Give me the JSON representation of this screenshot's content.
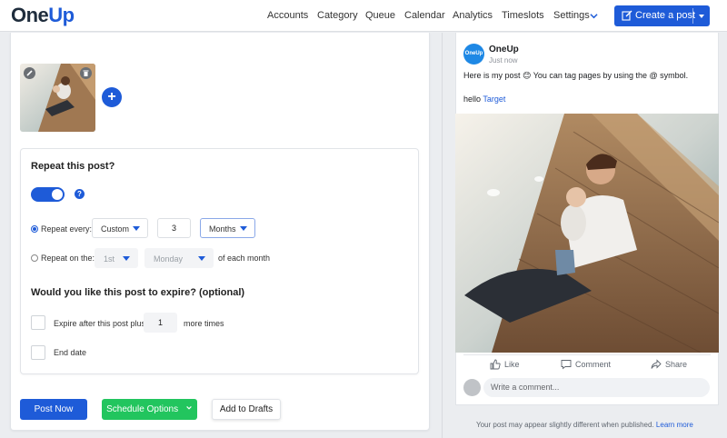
{
  "brand": {
    "logo_one": "One",
    "logo_up": "Up"
  },
  "nav": {
    "items": [
      "Accounts",
      "Category",
      "Queue",
      "Calendar",
      "Analytics",
      "Timeslots",
      "Settings"
    ],
    "create_label": "Create a post"
  },
  "repeat": {
    "title": "Repeat this post?",
    "enabled": true,
    "repeat_every_label": "Repeat every:",
    "repeat_every_mode": "Custom",
    "repeat_every_count": "3",
    "repeat_every_unit": "Months",
    "repeat_on_label": "Repeat on the:",
    "repeat_on_ordinal": "1st",
    "repeat_on_day": "Monday",
    "repeat_on_suffix": "of each month"
  },
  "expire": {
    "title": "Would you like this post to expire? (optional)",
    "after_label": "Expire after this post plus",
    "after_count": "1",
    "after_suffix": "more times",
    "end_date_label": "End date"
  },
  "actions": {
    "post_now": "Post Now",
    "schedule": "Schedule Options",
    "drafts": "Add to Drafts"
  },
  "preview": {
    "avatar_text": "OneUp",
    "account_name": "OneUp",
    "timestamp": "Just now",
    "body_line": "Here is my post 😊 You can tag pages by using the @ symbol.",
    "hello": "hello ",
    "tag": "Target",
    "like": "Like",
    "comment": "Comment",
    "share": "Share",
    "comment_placeholder": "Write a comment...",
    "disclaimer": "Your post may appear slightly different when published.",
    "learn_more": "Learn more"
  },
  "colors": {
    "primary": "#1e5bd8",
    "success": "#22c55e"
  }
}
